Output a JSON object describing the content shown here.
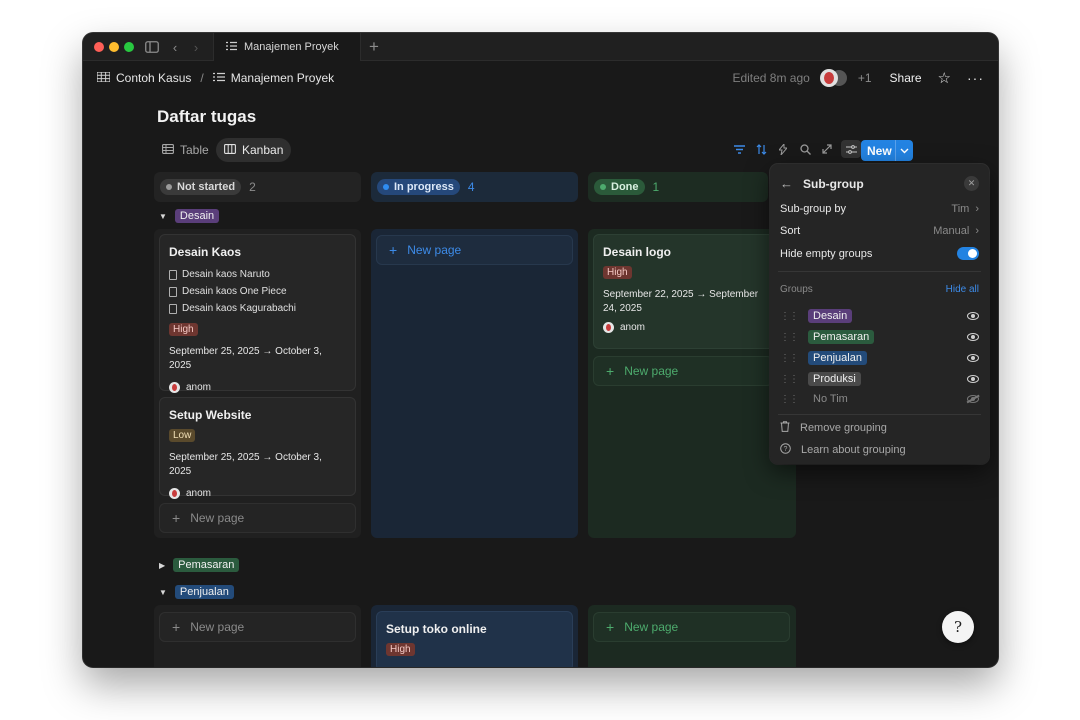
{
  "window": {
    "tab_title": "Manajemen Proyek"
  },
  "header": {
    "breadcrumb": [
      "Contoh Kasus",
      "Manajemen Proyek"
    ],
    "edited": "Edited 8m ago",
    "extra_users": "+1",
    "share_label": "Share"
  },
  "page": {
    "title": "Daftar tugas"
  },
  "views": [
    {
      "label": "Table",
      "icon": "table-icon",
      "active": false
    },
    {
      "label": "Kanban",
      "icon": "kanban-icon",
      "active": true
    }
  ],
  "toolbar": {
    "new_label": "New"
  },
  "columns": [
    {
      "label": "Not started",
      "count": "2",
      "color": "#9b9b9b"
    },
    {
      "label": "In progress",
      "count": "4",
      "color": "#2383e2"
    },
    {
      "label": "Done",
      "count": "1",
      "color": "#4dab6d"
    }
  ],
  "groups": {
    "desain": "Desain",
    "pemasaran": "Pemasaran",
    "penjualan": "Penjualan"
  },
  "cards": {
    "desain_kaos": {
      "title": "Desain Kaos",
      "subitems": [
        "Desain kaos Naruto",
        "Desain kaos One Piece",
        "Desain kaos Kagurabachi"
      ],
      "priority": "High",
      "date": "September 25, 2025 → October 3, 2025",
      "assignee": "anom"
    },
    "setup_website": {
      "title": "Setup Website",
      "priority": "Low",
      "date": "September 25, 2025 → October 3, 2025",
      "assignee": "anom"
    },
    "desain_logo": {
      "title": "Desain logo",
      "priority": "High",
      "date": "September 22, 2025 → September 24, 2025",
      "date_line1": "September 22, 2025 → September 24,",
      "date_line2": "2025",
      "assignee": "anom"
    },
    "setup_toko": {
      "title": "Setup toko online",
      "priority": "High"
    }
  },
  "new_page_label": "New page",
  "panel": {
    "title": "Sub-group",
    "subgroup_by_label": "Sub-group by",
    "subgroup_by_value": "Tim",
    "sort_label": "Sort",
    "sort_value": "Manual",
    "hide_empty_label": "Hide empty groups",
    "hide_empty": true,
    "groups_label": "Groups",
    "hide_all_label": "Hide all",
    "groups": [
      {
        "name": "Desain",
        "color": "#5a3e7a",
        "visible": true
      },
      {
        "name": "Pemasaran",
        "color": "#2b5b3e",
        "visible": true
      },
      {
        "name": "Penjualan",
        "color": "#234b7a",
        "visible": true
      },
      {
        "name": "Produksi",
        "color": "#4a4a4a",
        "visible": true
      },
      {
        "name": "No Tim",
        "color": "",
        "visible": false
      }
    ],
    "remove_label": "Remove grouping",
    "learn_label": "Learn about grouping"
  }
}
